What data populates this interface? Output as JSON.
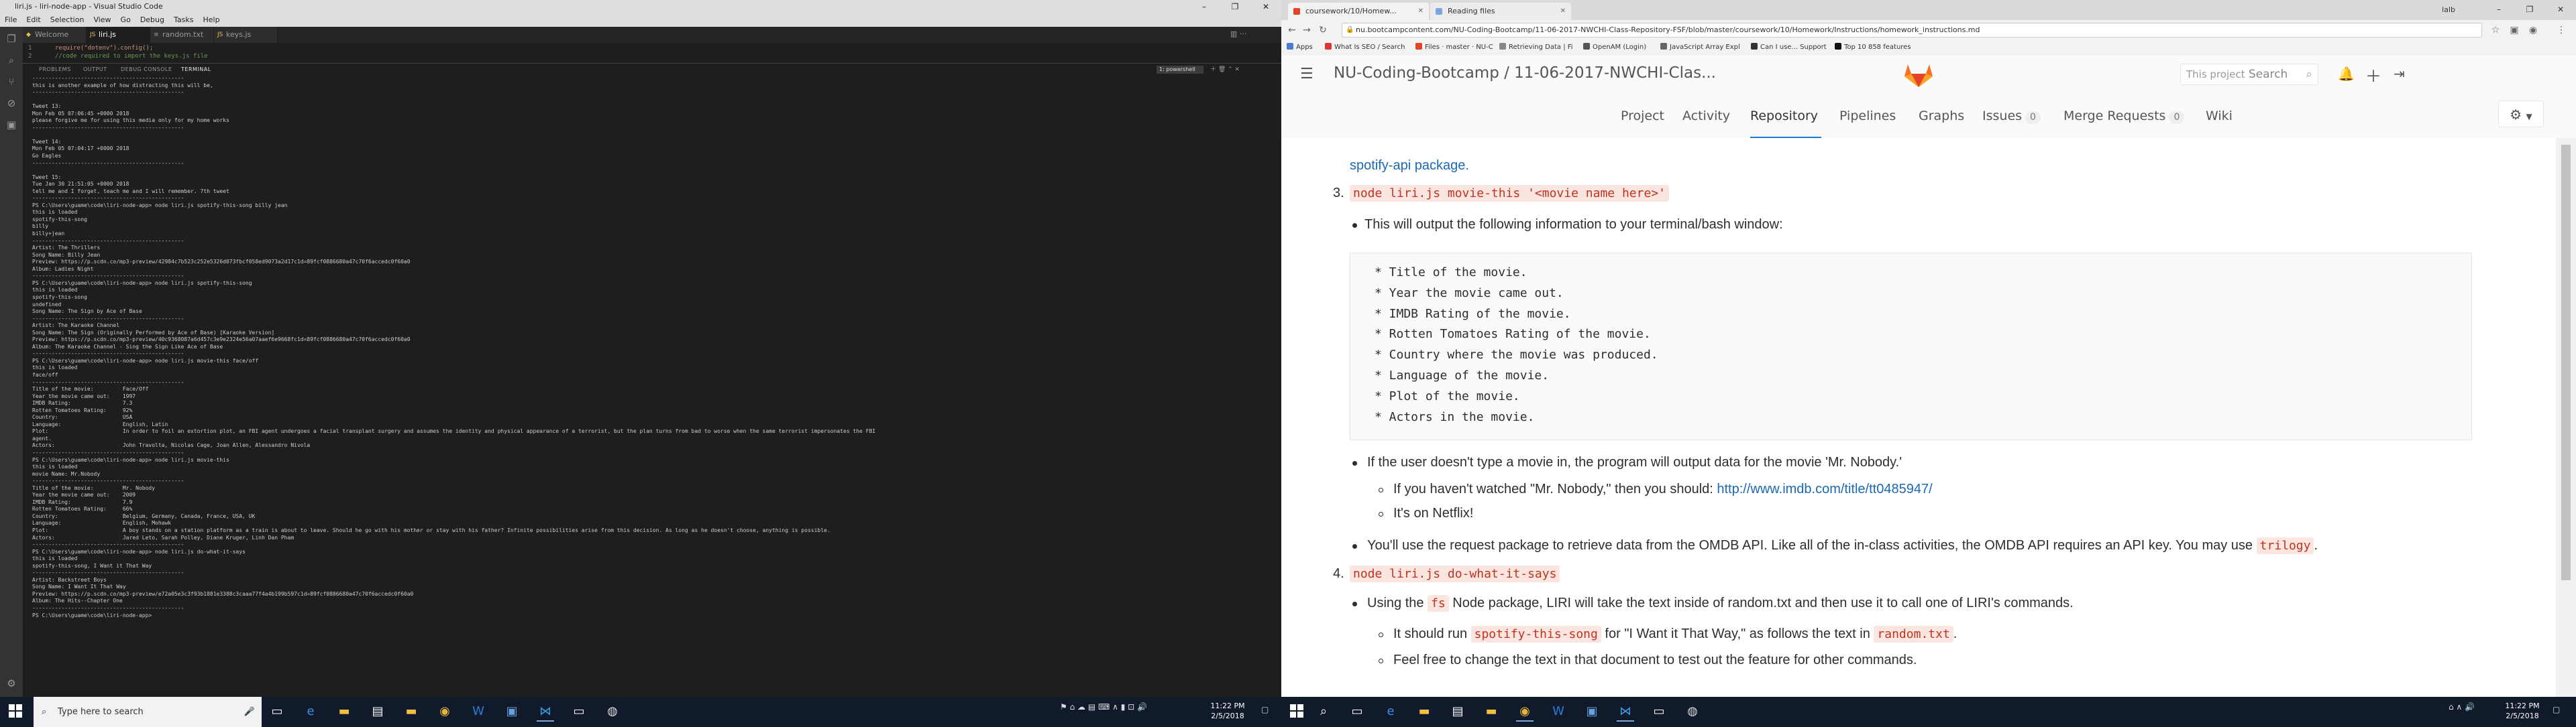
{
  "vscode": {
    "title": "liri.js - liri-node-app - Visual Studio Code",
    "menu": [
      "File",
      "Edit",
      "Selection",
      "View",
      "Go",
      "Debug",
      "Tasks",
      "Help"
    ],
    "tabs": [
      "Welcome",
      "liri.js",
      "random.txt",
      "keys.js"
    ],
    "editor_lines": [
      {
        "n": "1",
        "code": "require(\"dotenv\").config();"
      },
      {
        "n": "2",
        "code": "//code required to import the keys.js file"
      }
    ],
    "panel_tabs": [
      "PROBLEMS",
      "OUTPUT",
      "DEBUG CONSOLE",
      "TERMINAL"
    ],
    "terminal_select": "1: powershell",
    "terminal_lines": [
      "-----------------------------------------------",
      "this is another example of how distracting this will be,",
      "-----------------------------------------------",
      "",
      "Tweet 13:",
      "Mon Feb 05 07:06:45 +0000 2018",
      "please forgive me for using this media only for my home works",
      "-----------------------------------------------",
      "",
      "Tweet 14:",
      "Mon Feb 05 07:04:17 +0000 2018",
      "Go Eagles",
      "-----------------------------------------------",
      "",
      "Tweet 15:",
      "Tue Jan 30 21:51:05 +0000 2018",
      "tell me and I forget, teach me and I will remember. 7th tweet",
      "-----------------------------------------------",
      "PS C:\\Users\\guame\\code\\liri-node-app> node liri.js spotify-this-song billy jean",
      "this is loaded",
      "spotify-this-song",
      "billy",
      "billy+jean",
      "-----------------------------------------------",
      "Artist: The Thrillers",
      "Song Name: Billy Jean",
      "Preview: https://p.scdn.co/mp3-preview/42984c7b523c252e5326d073fbcf058ed9073a2d17c1d=89fcf0886680a47c70f6accedc0f60a0",
      "Album: Ladies Night",
      "-----------------------------------------------",
      "PS C:\\Users\\guame\\code\\liri-node-app> node liri.js spotify-this-song",
      "this is loaded",
      "spotify-this-song",
      "undefined",
      "Song Name: The Sign by Ace of Base",
      "-----------------------------------------------",
      "Artist: The Karaoke Channel",
      "Song Name: The Sign (Originally Performed by Ace of Base) [Karaoke Version]",
      "Preview: https://p.scdn.co/mp3-preview/40c9368087a6d457c3e9e2324e56a07aaef6e9668fc1d=89fcf0886680a47c70f6accedc0f60a0",
      "Album: The Karaoke Channel - Sing the Sign Like Ace of Base",
      "-----------------------------------------------",
      "PS C:\\Users\\guame\\code\\liri-node-app> node liri.js movie-this face/off",
      "this is loaded",
      "face/off",
      "-----------------------------------------------",
      "Title of the movie:         Face/Off",
      "Year the movie came out:    1997",
      "IMDB Rating:                7.3",
      "Rotten Tomatoes Rating:     92%",
      "Country:                    USA",
      "Language:                   English, Latin",
      "Plot:                       In order to foil an extortion plot, an FBI agent undergoes a facial transplant surgery and assumes the identity and physical appearance of a terrorist, but the plan turns from bad to worse when the same terrorist impersonates the FBI",
      "agent.",
      "Actors:                     John Travolta, Nicolas Cage, Joan Allen, Alessandro Nivola",
      "-----------------------------------------------",
      "PS C:\\Users\\guame\\code\\liri-node-app> node liri.js movie-this",
      "this is loaded",
      "movie Name: Mr.Nobody",
      "-----------------------------------------------",
      "Title of the movie:         Mr. Nobody",
      "Year the movie came out:    2009",
      "IMDB Rating:                7.9",
      "Rotten Tomatoes Rating:     66%",
      "Country:                    Belgium, Germany, Canada, France, USA, UK",
      "Language:                   English, Mohawk",
      "Plot:                       A boy stands on a station platform as a train is about to leave. Should he go with his mother or stay with his father? Infinite possibilities arise from this decision. As long as he doesn't choose, anything is possible.",
      "Actors:                     Jared Leto, Sarah Polley, Diane Kruger, Linh Dan Pham",
      "-----------------------------------------------",
      "PS C:\\Users\\guame\\code\\liri-node-app> node liri.js do-what-it-says",
      "this is loaded",
      "spotify-this-song, I Want it That Way",
      "-----------------------------------------------",
      "Artist: Backstreet Boys",
      "Song Name: I Want It That Way",
      "Preview: https://p.scdn.co/mp3-preview/e72a05e3c3f93b1881e3388c3caaa77f4a4b199b597c1d=89fcf0886680a47c70f6accedc0f60a0",
      "Album: The Hits--Chapter One",
      "-----------------------------------------------",
      "PS C:\\Users\\guame\\code\\liri-node-app> "
    ]
  },
  "chrome": {
    "tabs": [
      "coursework/10/Homew...",
      "Reading files"
    ],
    "user": "lalb",
    "url": "nu.bootcampcontent.com/NU-Coding-Bootcamp/11-06-2017-NWCHI-Class-Repository-FSF/blob/master/coursework/10/Homework/Instructions/homework_instructions.md",
    "bookmarks": [
      "Apps",
      "What Is SEO / Search",
      "Files · master · NU-C",
      "Retrieving Data | Fi",
      "OpenAM (Login)",
      "JavaScript Array Expl",
      "Can I use... Support",
      "Top 10 858 features"
    ]
  },
  "gitlab": {
    "title": "NU-Coding-Bootcamp / 11-06-2017-NWCHI-Clas...",
    "search_scope": "This project",
    "search_placeholder": "Search",
    "tabs": [
      {
        "label": "Project"
      },
      {
        "label": "Activity"
      },
      {
        "label": "Repository"
      },
      {
        "label": "Pipelines"
      },
      {
        "label": "Graphs"
      },
      {
        "label": "Issues",
        "badge": "0"
      },
      {
        "label": "Merge Requests",
        "badge": "0"
      },
      {
        "label": "Wiki"
      }
    ],
    "content": {
      "top_link": "spotify-api package.",
      "cmd3_num": "3.",
      "cmd3_code": "node liri.js movie-this '<movie name here>'",
      "output_intro": "This will output the following information to your terminal/bash window:",
      "pre_lines": [
        "* Title of the movie.",
        "* Year the movie came out.",
        "* IMDB Rating of the movie.",
        "* Rotten Tomatoes Rating of the movie.",
        "* Country where the movie was produced.",
        "* Language of the movie.",
        "* Plot of the movie.",
        "* Actors in the movie."
      ],
      "nobody_text": "If the user doesn't type a movie in, the program will output data for the movie 'Mr. Nobody.'",
      "watch_text": "If you haven't watched \"Mr. Nobody,\" then you should: ",
      "watch_link": "http://www.imdb.com/title/tt0485947/",
      "netflix_text": "It's on Netflix!",
      "request_text": "You'll use the request package to retrieve data from the OMDB API. Like all of the in-class activities, the OMDB API requires an API key. You may use ",
      "request_code": "trilogy",
      "request_end": ".",
      "cmd4_num": "4.",
      "cmd4_code": "node liri.js do-what-it-says",
      "using_pre": "Using the ",
      "using_code": "fs",
      "using_post": " Node package, LIRI will take the text inside of random.txt and then use it to call one of LIRI's commands.",
      "run_pre": "It should run ",
      "run_code": "spotify-this-song",
      "run_mid": " for \"I Want it That Way,\" as follows the text in ",
      "run_code2": "random.txt",
      "run_end": ".",
      "feel_text": "Feel free to change the text in that document to test out the feature for other commands."
    }
  },
  "taskbar": {
    "search_placeholder": "Type here to search",
    "time": "11:22 PM",
    "date": "2/5/2018"
  },
  "colors": {
    "vscode_bg": "#1e1e1e",
    "gitlab_active": "#1f78d1",
    "code_red": "#c0341d",
    "link_blue": "#1b69b6",
    "taskbar": "#101a2b"
  }
}
